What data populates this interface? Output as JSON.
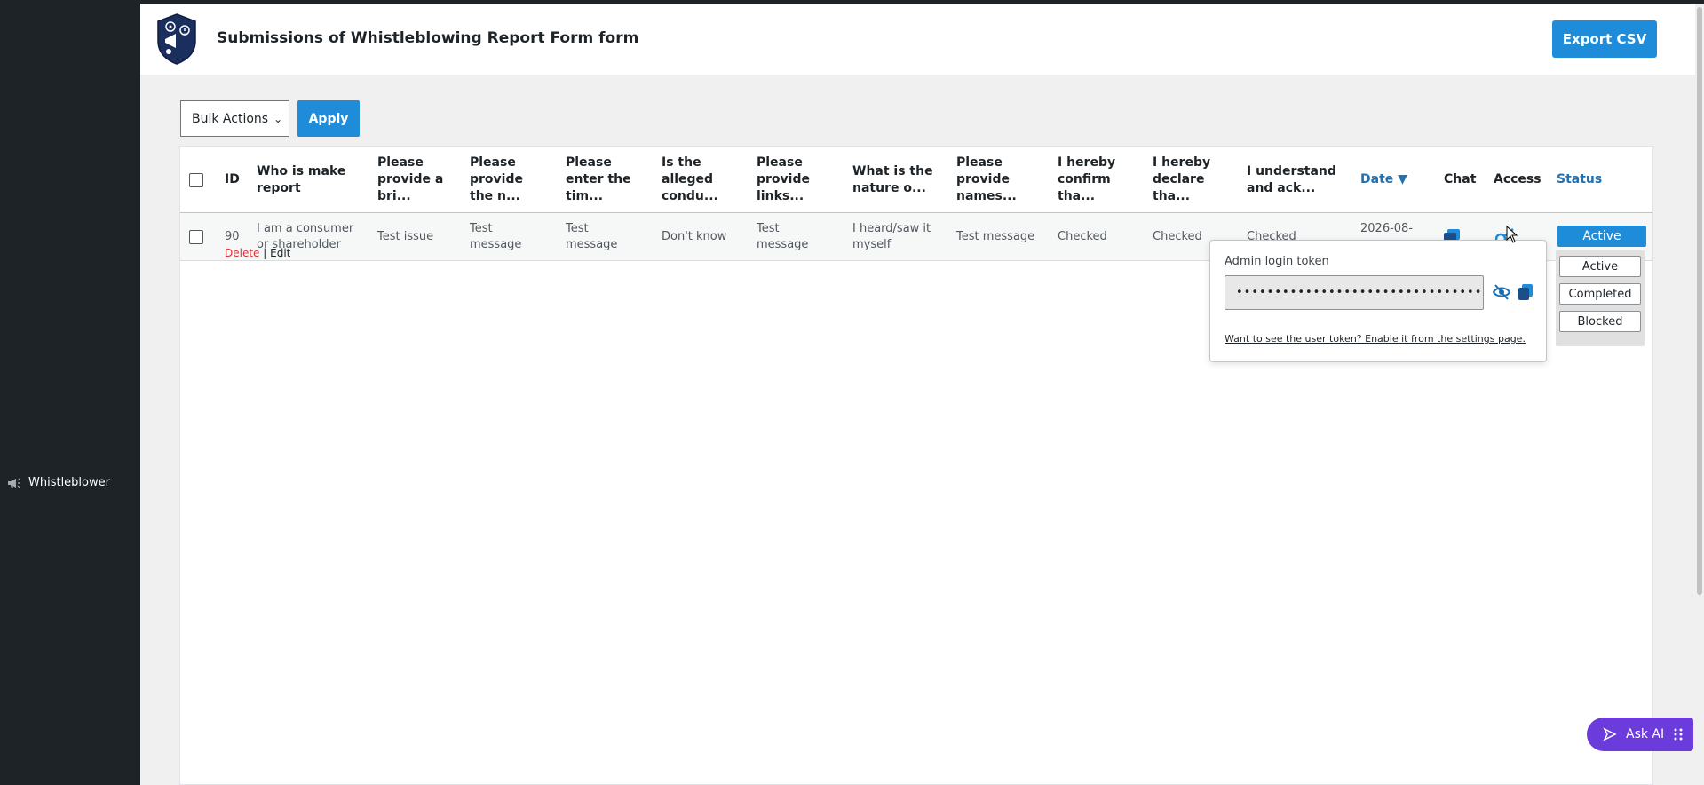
{
  "sidebar": {
    "item_label": "Whistleblower"
  },
  "header": {
    "title": "Submissions of Whistleblowing Report Form form",
    "export_label": "Export CSV"
  },
  "toolbar": {
    "bulk_actions_label": "Bulk Actions",
    "apply_label": "Apply"
  },
  "table": {
    "columns": [
      "ID",
      "Who is make report",
      "Please provide a bri...",
      "Please provide the n...",
      "Please enter the tim...",
      "Is the alleged condu...",
      "Please provide links...",
      "What is the nature o...",
      "Please provide names...",
      "I hereby confirm tha...",
      "I hereby declare tha...",
      "I understand and ack...",
      "Date ▼",
      "Chat",
      "Access",
      "Status"
    ],
    "rows": [
      {
        "id": "90",
        "cells": [
          "I am a consumer or shareholder",
          "Test issue",
          "Test message",
          "Test message",
          "Don't know",
          "Test message",
          "I heard/saw it myself",
          "Test message",
          "Checked",
          "Checked",
          "Checked",
          "2026-08-"
        ],
        "delete_label": "Delete",
        "edit_label": "| Edit",
        "status": "Active"
      }
    ]
  },
  "token_popup": {
    "label": "Admin login token",
    "value": "••••••••••••••••••••••••••••••••",
    "link": "Want to see the user token? Enable it from the settings page."
  },
  "status_menu": {
    "options": [
      "Active",
      "Completed",
      "Blocked"
    ]
  },
  "ask_ai": {
    "label": "Ask AI"
  },
  "colors": {
    "accent": "#1e8cd9",
    "sidebar": "#1d2327",
    "ask_ai": "#6b3bdb",
    "delete": "#d63638"
  }
}
